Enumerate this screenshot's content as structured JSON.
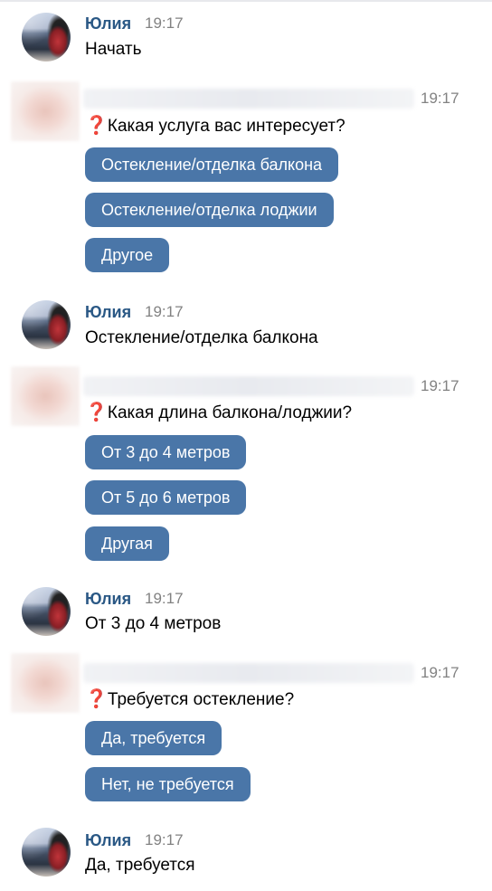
{
  "user": {
    "name": "Юлия"
  },
  "icons": {
    "question": "red-question-mark-icon"
  },
  "colors": {
    "button_bg": "#4a76a8",
    "button_text": "#ffffff",
    "name": "#2a5885",
    "time": "#828282",
    "question_mark": "#d22e2e"
  },
  "messages": [
    {
      "type": "user",
      "name": "Юлия",
      "time": "19:17",
      "text": "Начать"
    },
    {
      "type": "bot",
      "time": "19:17",
      "question_mark": "❓",
      "text": "Какая услуга вас интересует?",
      "buttons": [
        "Остекление/отделка балкона",
        "Остекление/отделка лоджии",
        "Другое"
      ]
    },
    {
      "type": "user",
      "name": "Юлия",
      "time": "19:17",
      "text": "Остекление/отделка балкона"
    },
    {
      "type": "bot",
      "time": "19:17",
      "question_mark": "❓",
      "text": "Какая длина балкона/лоджии?",
      "buttons": [
        "От 3 до 4 метров",
        "От 5 до 6 метров",
        "Другая"
      ]
    },
    {
      "type": "user",
      "name": "Юлия",
      "time": "19:17",
      "text": "От 3 до 4 метров"
    },
    {
      "type": "bot",
      "time": "19:17",
      "question_mark": "❓",
      "text": "Требуется остекление?",
      "buttons": [
        "Да, требуется",
        "Нет, не требуется"
      ]
    },
    {
      "type": "user",
      "name": "Юлия",
      "time": "19:17",
      "text": "Да, требуется"
    }
  ]
}
